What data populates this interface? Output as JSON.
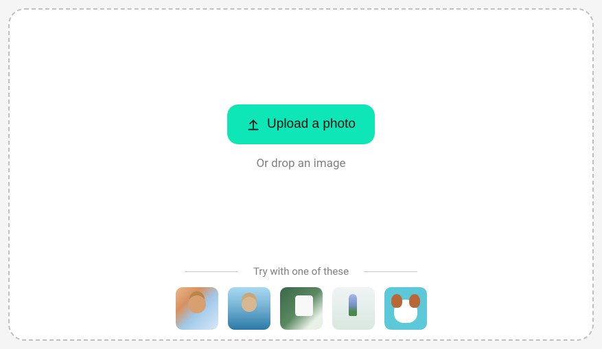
{
  "upload": {
    "button_label": "Upload a photo",
    "drop_text": "Or drop an image"
  },
  "samples": {
    "title": "Try with one of these",
    "items": [
      {
        "name": "sample-person-male"
      },
      {
        "name": "sample-person-female"
      },
      {
        "name": "sample-product-jar"
      },
      {
        "name": "sample-flower"
      },
      {
        "name": "sample-dog"
      }
    ]
  }
}
